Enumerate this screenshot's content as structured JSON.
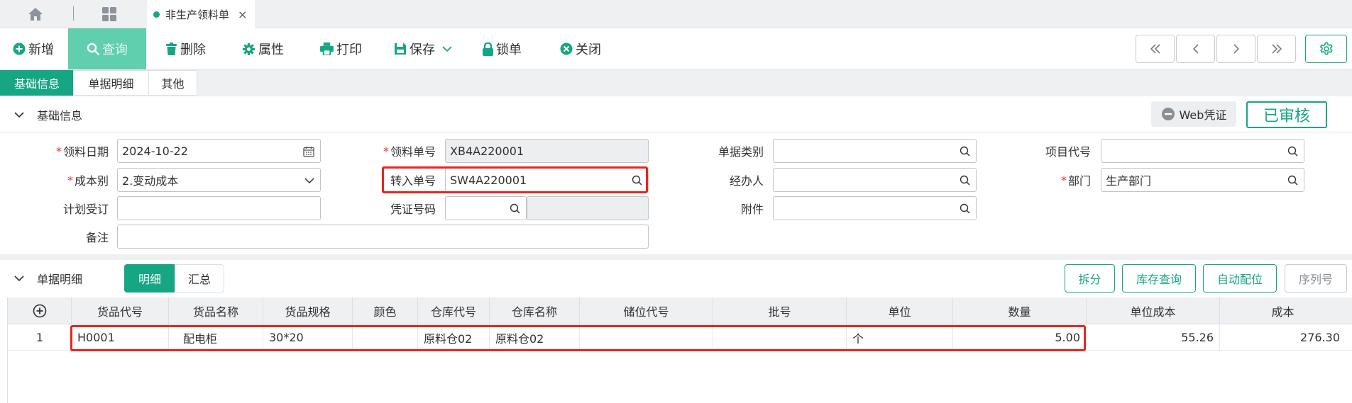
{
  "tabs": {
    "home_icon": "home-icon",
    "apps_icon": "grid-icon",
    "doc_tab_label": "非生产领料单",
    "close_glyph": "×"
  },
  "toolbar": {
    "add": "新增",
    "query": "查询",
    "delete": "删除",
    "properties": "属性",
    "print": "打印",
    "save": "保存",
    "lock": "锁单",
    "close": "关闭"
  },
  "subtabs": [
    "基础信息",
    "单据明细",
    "其他"
  ],
  "basic_section": {
    "title": "基础信息",
    "web_voucher": "Web凭证",
    "status": "已审核"
  },
  "form": {
    "pick_date": {
      "label": "领料日期",
      "value": "2024-10-22"
    },
    "pick_no": {
      "label": "领料单号",
      "value": "XB4A220001"
    },
    "doc_type": {
      "label": "单据类别",
      "value": ""
    },
    "project_code": {
      "label": "项目代号",
      "value": ""
    },
    "cost_type": {
      "label": "成本别",
      "value": "2.变动成本"
    },
    "transfer_no": {
      "label": "转入单号",
      "value": "SW4A220001"
    },
    "handler": {
      "label": "经办人",
      "value": ""
    },
    "department": {
      "label": "部门",
      "value": "生产部门"
    },
    "plan_acceptance": {
      "label": "计划受订",
      "value": ""
    },
    "voucher_no": {
      "label": "凭证号码",
      "value": "",
      "value2": ""
    },
    "attachment": {
      "label": "附件",
      "value": ""
    },
    "remark": {
      "label": "备注",
      "value": ""
    }
  },
  "detail_section": {
    "title": "单据明细",
    "seg_detail": "明细",
    "seg_summary": "汇总",
    "split": "拆分",
    "stock_query": "库存查询",
    "auto_allocate": "自动配位",
    "serial_no": "序列号"
  },
  "table": {
    "columns": [
      "货品代号",
      "货品名称",
      "货品规格",
      "颜色",
      "仓库代号",
      "仓库名称",
      "储位代号",
      "批号",
      "单位",
      "数量",
      "单位成本",
      "成本"
    ],
    "rows": [
      {
        "no": "1",
        "code": "H0001",
        "name": "配电柜",
        "spec": "30*20",
        "color": "",
        "wh_code": "原料仓02",
        "wh_name": "原料仓02",
        "bin": "",
        "batch": "",
        "unit": "个",
        "qty": "5.00",
        "unit_cost": "55.26",
        "cost": "276.30"
      }
    ]
  },
  "colors": {
    "accent": "#16a683",
    "highlight": "#e8251e",
    "required": "#e53935"
  }
}
